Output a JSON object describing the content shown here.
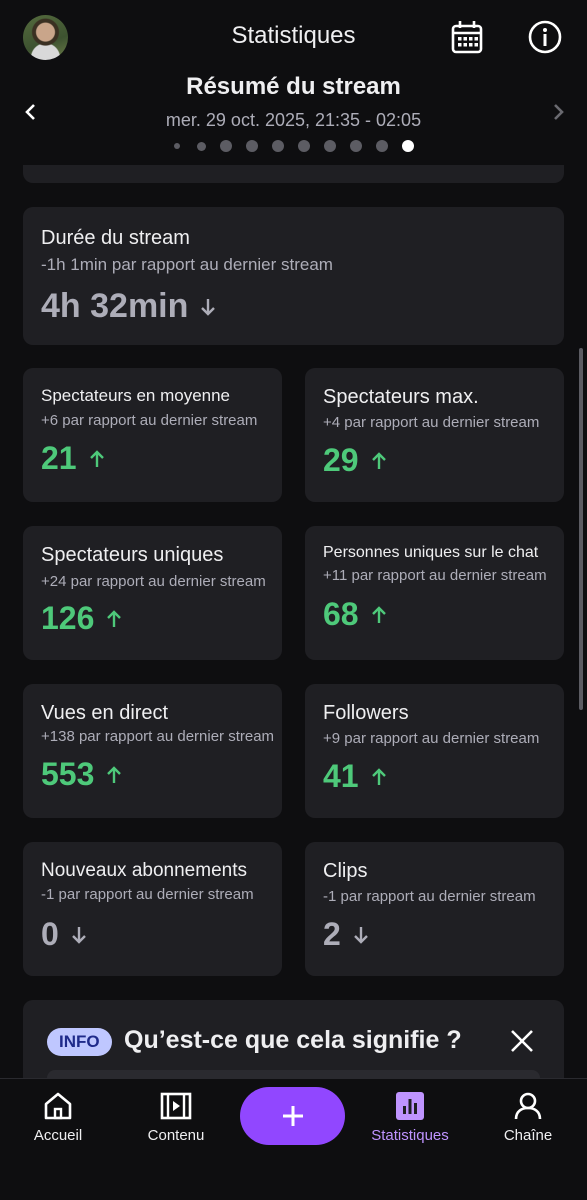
{
  "header": {
    "title": "Statistiques"
  },
  "summary": {
    "title": "Résumé du stream",
    "date": "mer. 29 oct. 2025, 21:35 - 02:05"
  },
  "duration": {
    "label": "Durée du stream",
    "sub": "-1h 1min par rapport au dernier stream",
    "value": "4h 32min",
    "trend": "down"
  },
  "stats": [
    {
      "label": "Spectateurs en moyenne",
      "sub": "+6 par rapport au dernier stream",
      "value": "21",
      "trend": "up"
    },
    {
      "label": "Spectateurs max.",
      "sub": "+4 par rapport au dernier stream",
      "value": "29",
      "trend": "up"
    },
    {
      "label": "Spectateurs uniques",
      "sub": "+24 par rapport au dernier stream",
      "value": "126",
      "trend": "up"
    },
    {
      "label": "Personnes uniques sur le chat",
      "sub": "+11 par rapport au dernier stream",
      "value": "68",
      "trend": "up"
    },
    {
      "label": "Vues en direct",
      "sub": "+138 par rapport au dernier stream",
      "value": "553",
      "trend": "up"
    },
    {
      "label": "Followers",
      "sub": "+9 par rapport au dernier stream",
      "value": "41",
      "trend": "up"
    },
    {
      "label": "Nouveaux abonnements",
      "sub": "-1 par rapport au dernier stream",
      "value": "0",
      "trend": "down"
    },
    {
      "label": "Clips",
      "sub": "-1 par rapport au dernier stream",
      "value": "2",
      "trend": "down"
    }
  ],
  "info": {
    "badge": "INFO",
    "heading": "Qu’est-ce que cela signifie ?"
  },
  "nav": {
    "home": "Accueil",
    "content": "Contenu",
    "stats": "Statistiques",
    "channel": "Chaîne"
  },
  "colors": {
    "up": "#4ec97a",
    "accent": "#9147ff",
    "active_nav": "#bf94ff",
    "info_badge": "#bfc7ff"
  },
  "icons": {
    "calendar": "calendar-icon",
    "info": "info-icon",
    "prev": "chevron-left-icon",
    "next": "chevron-right-icon"
  }
}
